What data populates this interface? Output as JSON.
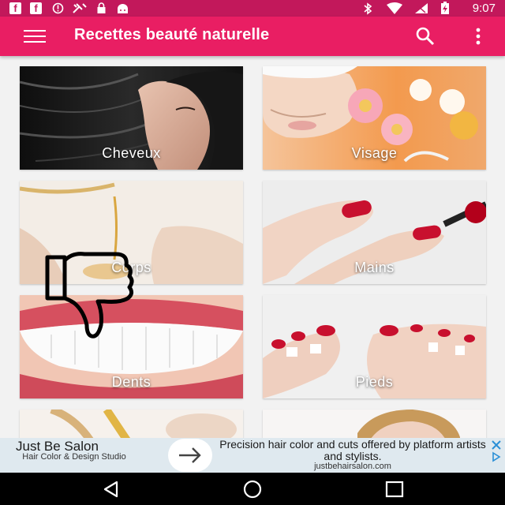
{
  "status_bar": {
    "time": "9:07",
    "icons": [
      "facebook-icon",
      "facebook-icon",
      "alert-icon",
      "tools-icon",
      "lock-icon",
      "android-icon",
      "bluetooth-icon",
      "wifi-icon",
      "signal-icon",
      "battery-charging-icon"
    ]
  },
  "app_bar": {
    "title": "Recettes beauté naturelle",
    "menu_icon": "hamburger-menu-icon",
    "search_icon": "search-icon",
    "more_icon": "more-vertical-icon",
    "color": "#e91e63"
  },
  "categories": [
    {
      "label": "Cheveux"
    },
    {
      "label": "Visage"
    },
    {
      "label": "Corps"
    },
    {
      "label": "Mains"
    },
    {
      "label": "Dents"
    },
    {
      "label": "Pieds"
    },
    {
      "label": ""
    },
    {
      "label": ""
    }
  ],
  "ad": {
    "title": "Just Be Salon",
    "subtitle": "Hair Color & Design Studio",
    "text": "Precision hair color and cuts offered by platform artists and stylists.",
    "url": "justbehairsalon.com",
    "arrow_icon": "arrow-right-icon",
    "close_icon": "close-icon"
  },
  "nav_bar": {
    "icons": [
      "back-icon",
      "home-icon",
      "recents-icon"
    ]
  }
}
